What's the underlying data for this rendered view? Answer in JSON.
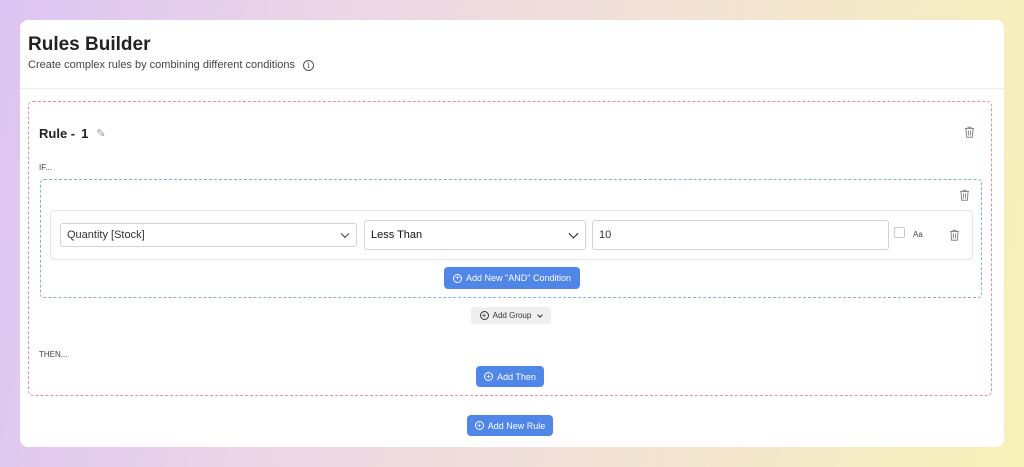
{
  "header": {
    "title": "Rules Builder",
    "subtitle": "Create complex rules by combining different conditions",
    "info_icon": "i"
  },
  "rule": {
    "label": "Rule -",
    "number": "1",
    "if_label": "IF...",
    "then_label": "THEN...",
    "group": {
      "condition": {
        "field_value": "Quantity [Stock]",
        "operator_value": "Less Than",
        "input_value": "10",
        "case_sensitive_label": "Aa",
        "case_sensitive_checked": false
      },
      "add_and_label": "Add New \"AND\" Condition"
    },
    "add_group_label": "Add Group",
    "add_then_label": "Add Then"
  },
  "add_rule_label": "Add New Rule",
  "icons": {
    "plus": "⊕",
    "pencil": "✎"
  },
  "colors": {
    "primary": "#4f86e8",
    "rule_border": "#e58bb0",
    "group_border": "#7bb3e0"
  }
}
